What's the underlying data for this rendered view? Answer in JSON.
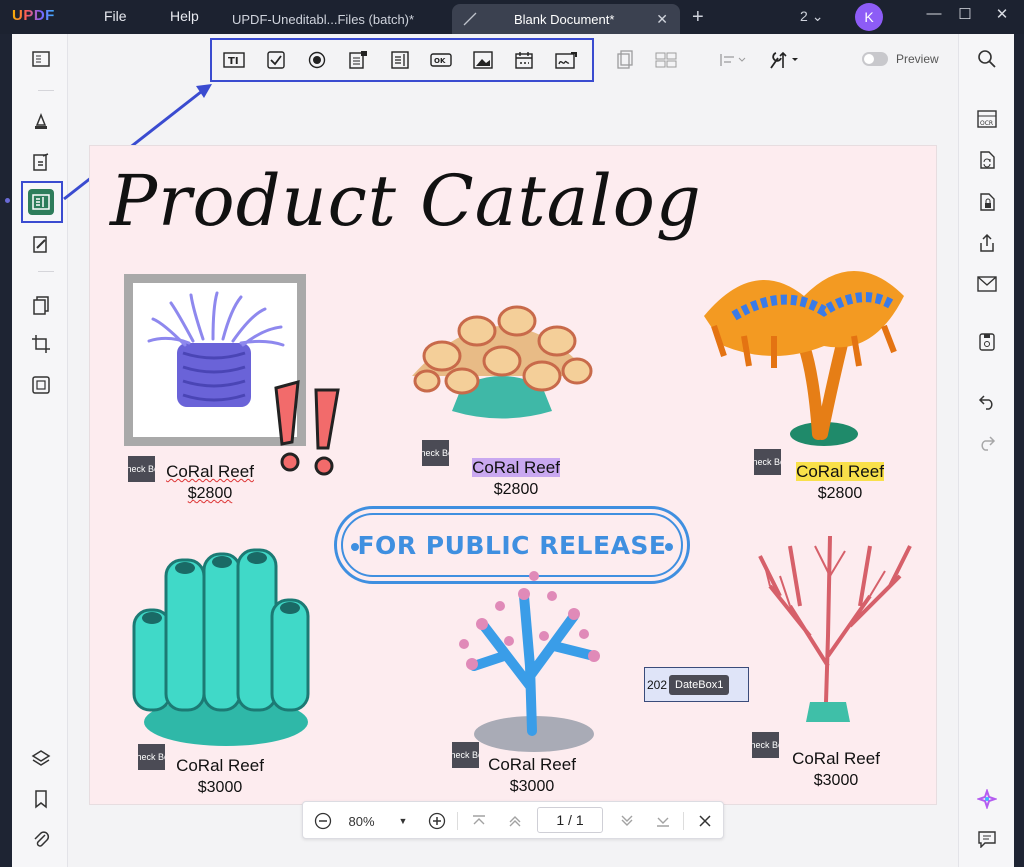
{
  "app": {
    "logo": "UPDF"
  },
  "menu": {
    "file": "File",
    "help": "Help"
  },
  "tabs": [
    {
      "label": "UPDF-Uneditabl...Files (batch)*"
    },
    {
      "label": "Blank Document*"
    }
  ],
  "window": {
    "count": "2",
    "avatar": "K"
  },
  "toolbar": {
    "preview": "Preview"
  },
  "document": {
    "title": "Product Catalog",
    "stamp": "FOR PUBLIC RELEASE",
    "products": [
      {
        "name": "CoRal Reef",
        "price": "$2800"
      },
      {
        "name": "CoRal Reef",
        "price": "$2800"
      },
      {
        "name": "CoRal Reef",
        "price": "$2800"
      },
      {
        "name": "CoRal Reef",
        "price": "$3000"
      },
      {
        "name": "CoRal Reef",
        "price": "$3000"
      },
      {
        "name": "CoRal Reef",
        "price": "$3000"
      }
    ],
    "checkbox_label": "Check Box",
    "datebox": {
      "value": "202",
      "tag": "DateBox1"
    }
  },
  "nav": {
    "zoom": "80%",
    "page": "1 / 1"
  },
  "colors": {
    "accent": "#3a4bd0",
    "stamp": "#3f8fe0",
    "avatar": "#8d5cf6",
    "highlight_purple": "#c9a8f0",
    "highlight_yellow": "#f9e04a"
  }
}
